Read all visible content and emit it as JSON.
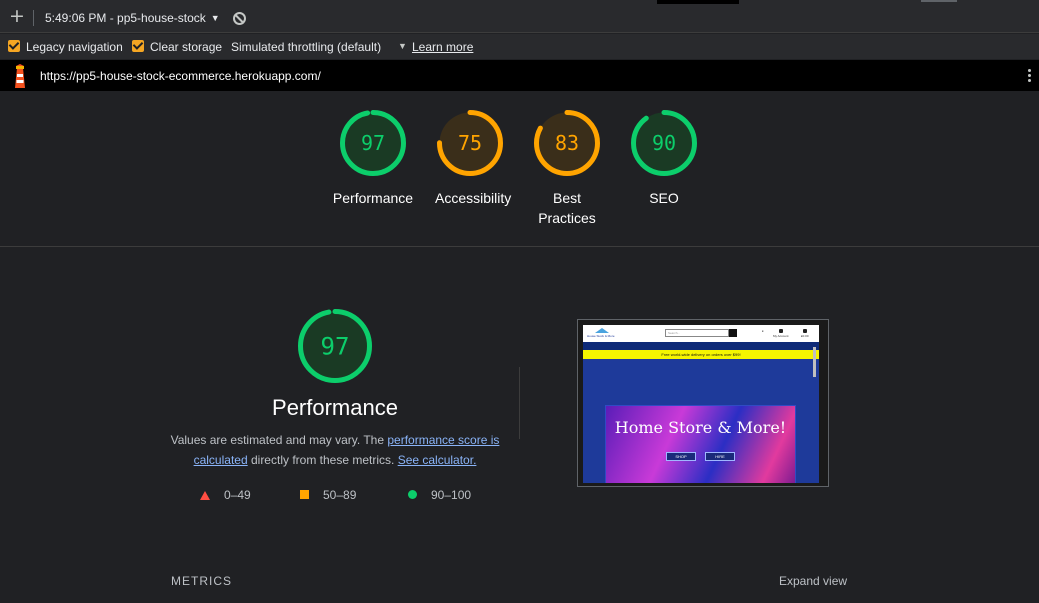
{
  "toolbar": {
    "add_icon": "plus-icon",
    "report_label": "5:49:06 PM - pp5-house-stock",
    "report_caret": "▼",
    "block_icon": "no-entry-icon"
  },
  "settings": {
    "legacy_navigation": "Legacy navigation",
    "clear_storage": "Clear storage",
    "throttling": "Simulated throttling (default)",
    "throttling_caret": "▼",
    "learn_more": "Learn more",
    "checked_color": "#f5a623"
  },
  "urlbar": {
    "url": "https://pp5-house-stock-ecommerce.herokuapp.com/",
    "lighthouse_icon": "lighthouse-icon",
    "menu_icon": "kebab-menu-icon"
  },
  "categories": [
    {
      "label": "Performance",
      "score": 97,
      "color": "#0cce6b",
      "fill": "#1a3a24"
    },
    {
      "label": "Accessibility",
      "score": 75,
      "color": "#ffa400",
      "fill": "#3a2e1a"
    },
    {
      "label": "Best Practices",
      "score": 83,
      "color": "#ffa400",
      "fill": "#3a2e1a"
    },
    {
      "label": "SEO",
      "score": 90,
      "color": "#0cce6b",
      "fill": "#1a3a24"
    }
  ],
  "performance": {
    "score": 97,
    "title": "Performance",
    "desc_before": "Values are estimated and may vary. The ",
    "desc_link1": "performance score is calculated",
    "desc_middle": " directly from these metrics. ",
    "desc_link2": "See calculator."
  },
  "legend": {
    "fail": "0–49",
    "average": "50–89",
    "pass": "90–100",
    "fail_color": "#ff4e42",
    "average_color": "#ffa400",
    "pass_color": "#0cce6b"
  },
  "screenshot": {
    "logo_text": "House Stock & More",
    "search_placeholder": "Search...",
    "icon_account": "My Account",
    "icon_bag": "£0.00",
    "icon_gb": "£",
    "nav": [
      "Home",
      "All Products ▾",
      "Clothing ▾",
      "Homeware ▾",
      "Special Offers ▾",
      "Hire ▾",
      "About ▾",
      "Contact us"
    ],
    "promo": "Free world-wide delivery on orders over $99!",
    "hero_title": "Home Store & More!",
    "shop_button": "SHOP",
    "hire_button": "HIRE"
  },
  "metrics": {
    "heading": "METRICS",
    "expand": "Expand view"
  }
}
